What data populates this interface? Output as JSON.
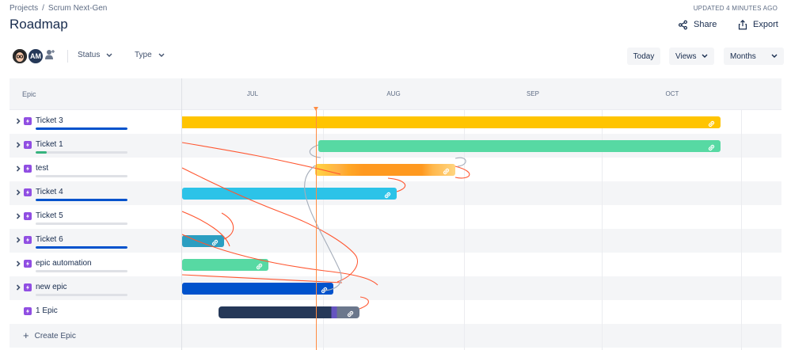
{
  "breadcrumb": {
    "projects": "Projects",
    "separator": "/",
    "project": "Scrum Next-Gen"
  },
  "page_title": "Roadmap",
  "updated": "UPDATED 4 MINUTES AGO",
  "actions": {
    "share": "Share",
    "export": "Export"
  },
  "avatars": {
    "second_initials": "AM"
  },
  "filters": {
    "status": "Status",
    "type": "Type"
  },
  "view_controls": {
    "today": "Today",
    "views": "Views",
    "months": "Months"
  },
  "table": {
    "epic_header": "Epic",
    "create_epic": "Create Epic"
  },
  "months": [
    "JUL",
    "AUG",
    "SEP",
    "OCT"
  ],
  "epics": [
    {
      "label": "Ticket 3",
      "progress": 1.0,
      "progress_color": "#0052cc",
      "bar_color": "#ffc400",
      "expandable": true
    },
    {
      "label": "Ticket 1",
      "progress": 0.12,
      "progress_color": "#36b37e",
      "bar_color": "#57d9a3",
      "expandable": true
    },
    {
      "label": "test",
      "progress": 0.0,
      "progress_color": "#0052cc",
      "bar_color": "#ff991f",
      "expandable": true
    },
    {
      "label": "Ticket 4",
      "progress": 1.0,
      "progress_color": "#0052cc",
      "bar_color": "#2cc3e8",
      "expandable": true
    },
    {
      "label": "Ticket 5",
      "progress": 0.0,
      "progress_color": "#0052cc",
      "bar_color": "",
      "expandable": true
    },
    {
      "label": "Ticket 6",
      "progress": 1.0,
      "progress_color": "#0052cc",
      "bar_color": "#2b9ec1",
      "expandable": true
    },
    {
      "label": "epic automation",
      "progress": 0.0,
      "progress_color": "#0052cc",
      "bar_color": "#57d9a3",
      "expandable": true
    },
    {
      "label": "new epic",
      "progress": 0.0,
      "progress_color": "#0052cc",
      "bar_color": "#0052cc",
      "expandable": true
    },
    {
      "label": "1 Epic",
      "progress": null,
      "progress_color": "",
      "bar_color": "#253858",
      "expandable": false
    }
  ],
  "colors": {
    "dependency_line": "#ff5630",
    "today_line": "#ff8b42",
    "epic_icon": "#904ee2"
  }
}
